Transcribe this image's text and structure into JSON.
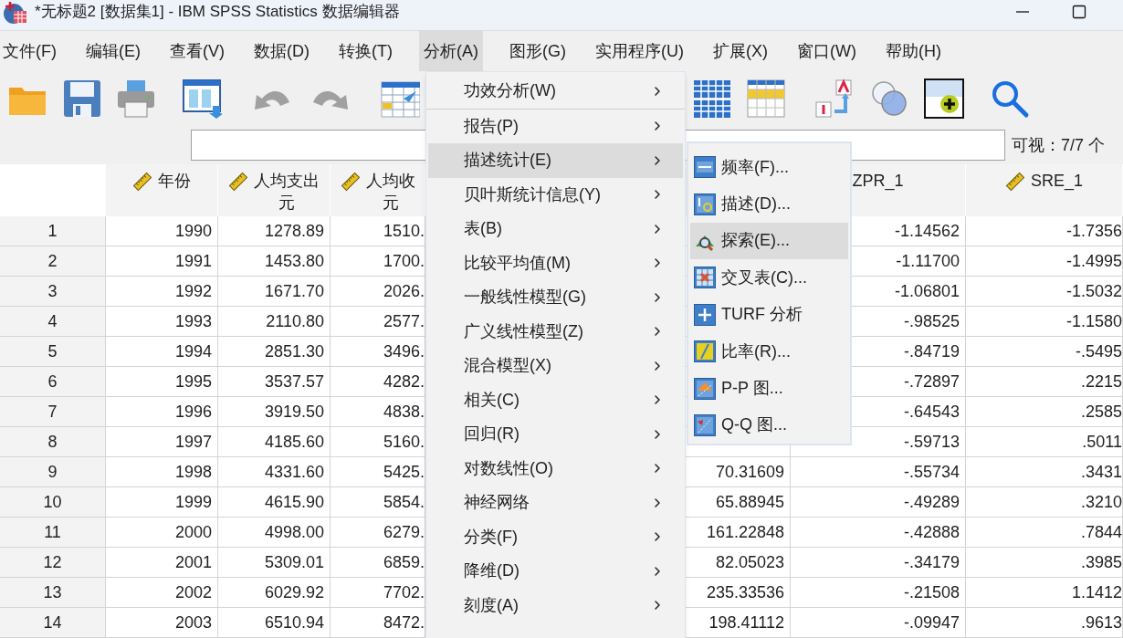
{
  "window": {
    "title": "*无标题2 [数据集1] - IBM SPSS Statistics 数据编辑器"
  },
  "menu_bar": [
    {
      "label": "文件(F)",
      "selected": false
    },
    {
      "label": "编辑(E)",
      "selected": false
    },
    {
      "label": "查看(V)",
      "selected": false
    },
    {
      "label": "数据(D)",
      "selected": false
    },
    {
      "label": "转换(T)",
      "selected": false
    },
    {
      "label": "分析(A)",
      "selected": true
    },
    {
      "label": "图形(G)",
      "selected": false
    },
    {
      "label": "实用程序(U)",
      "selected": false
    },
    {
      "label": "扩展(X)",
      "selected": false
    },
    {
      "label": "窗口(W)",
      "selected": false
    },
    {
      "label": "帮助(H)",
      "selected": false
    }
  ],
  "analyze_menu": {
    "items": [
      {
        "label": "功效分析(W)",
        "selected": false,
        "has_submenu": true,
        "separator_after": true
      },
      {
        "label": "报告(P)",
        "selected": false,
        "has_submenu": true,
        "separator_after": false
      },
      {
        "label": "描述统计(E)",
        "selected": true,
        "has_submenu": true,
        "separator_after": false
      },
      {
        "label": "贝叶斯统计信息(Y)",
        "selected": false,
        "has_submenu": true,
        "separator_after": false
      },
      {
        "label": "表(B)",
        "selected": false,
        "has_submenu": true,
        "separator_after": false
      },
      {
        "label": "比较平均值(M)",
        "selected": false,
        "has_submenu": true,
        "separator_after": false
      },
      {
        "label": "一般线性模型(G)",
        "selected": false,
        "has_submenu": true,
        "separator_after": false
      },
      {
        "label": "广义线性模型(Z)",
        "selected": false,
        "has_submenu": true,
        "separator_after": false
      },
      {
        "label": "混合模型(X)",
        "selected": false,
        "has_submenu": true,
        "separator_after": false
      },
      {
        "label": "相关(C)",
        "selected": false,
        "has_submenu": true,
        "separator_after": false
      },
      {
        "label": "回归(R)",
        "selected": false,
        "has_submenu": true,
        "separator_after": false
      },
      {
        "label": "对数线性(O)",
        "selected": false,
        "has_submenu": true,
        "separator_after": false
      },
      {
        "label": "神经网络",
        "selected": false,
        "has_submenu": true,
        "separator_after": false
      },
      {
        "label": "分类(F)",
        "selected": false,
        "has_submenu": true,
        "separator_after": false
      },
      {
        "label": "降维(D)",
        "selected": false,
        "has_submenu": true,
        "separator_after": false
      },
      {
        "label": "刻度(A)",
        "selected": false,
        "has_submenu": true,
        "separator_after": false
      }
    ]
  },
  "descriptive_submenu": {
    "items": [
      {
        "kind": "frequencies",
        "label": "频率(F)...",
        "selected": false
      },
      {
        "kind": "descriptives",
        "label": "描述(D)...",
        "selected": false
      },
      {
        "kind": "explore",
        "label": "探索(E)...",
        "selected": true
      },
      {
        "kind": "crosstabs",
        "label": "交叉表(C)...",
        "selected": false
      },
      {
        "kind": "turf",
        "label": "TURF 分析",
        "selected": false
      },
      {
        "kind": "ratio",
        "label": "比率(R)...",
        "selected": false
      },
      {
        "kind": "pp",
        "label": "P-P 图...",
        "selected": false
      },
      {
        "kind": "qq",
        "label": "Q-Q 图...",
        "selected": false
      }
    ]
  },
  "variable_bar": {
    "visible_count": "可视：7/7 个"
  },
  "table": {
    "columns": [
      {
        "label": "年份",
        "ruler": true
      },
      {
        "label": "人均支出",
        "unit": "元",
        "ruler": true
      },
      {
        "label": "人均收",
        "unit": "元",
        "ruler": true
      },
      {
        "label": "ZPR_1",
        "ruler": false
      },
      {
        "label": "SRE_1",
        "ruler": true
      }
    ],
    "rows": [
      {
        "number": "1",
        "cells": [
          "1990",
          "1278.89",
          "1510.",
          null,
          "-1.14562",
          "-1.7356"
        ]
      },
      {
        "number": "2",
        "cells": [
          "1991",
          "1453.80",
          "1700.",
          null,
          "-1.11700",
          "-1.4995"
        ]
      },
      {
        "number": "3",
        "cells": [
          "1992",
          "1671.70",
          "2026.",
          null,
          "-1.06801",
          "-1.5032"
        ]
      },
      {
        "number": "4",
        "cells": [
          "1993",
          "2110.80",
          "2577.",
          null,
          "-.98525",
          "-1.1580"
        ]
      },
      {
        "number": "5",
        "cells": [
          "1994",
          "2851.30",
          "3496.",
          null,
          "-.84719",
          "-.5495"
        ]
      },
      {
        "number": "6",
        "cells": [
          "1995",
          "3537.57",
          "4282.",
          null,
          "-.72897",
          ".2215"
        ]
      },
      {
        "number": "7",
        "cells": [
          "1996",
          "3919.50",
          "4838.",
          null,
          "-.64543",
          ".2585"
        ]
      },
      {
        "number": "8",
        "cells": [
          "1997",
          "4185.60",
          "5160.",
          null,
          "-.59713",
          ".5011"
        ]
      },
      {
        "number": "9",
        "cells": [
          "1998",
          "4331.60",
          "5425.",
          "70.31609",
          "-.55734",
          ".3431"
        ]
      },
      {
        "number": "10",
        "cells": [
          "1999",
          "4615.90",
          "5854.",
          "65.88945",
          "-.49289",
          ".3210"
        ]
      },
      {
        "number": "11",
        "cells": [
          "2000",
          "4998.00",
          "6279.",
          "161.22848",
          "-.42888",
          ".7844"
        ]
      },
      {
        "number": "12",
        "cells": [
          "2001",
          "5309.01",
          "6859.",
          "82.05023",
          "-.34179",
          ".3985"
        ]
      },
      {
        "number": "13",
        "cells": [
          "2002",
          "6029.92",
          "7702.",
          "235.33536",
          "-.21508",
          "1.1412"
        ]
      },
      {
        "number": "14",
        "cells": [
          "2003",
          "6510.94",
          "8472.",
          "198.41112",
          "-.09947",
          ".9613"
        ]
      }
    ]
  }
}
